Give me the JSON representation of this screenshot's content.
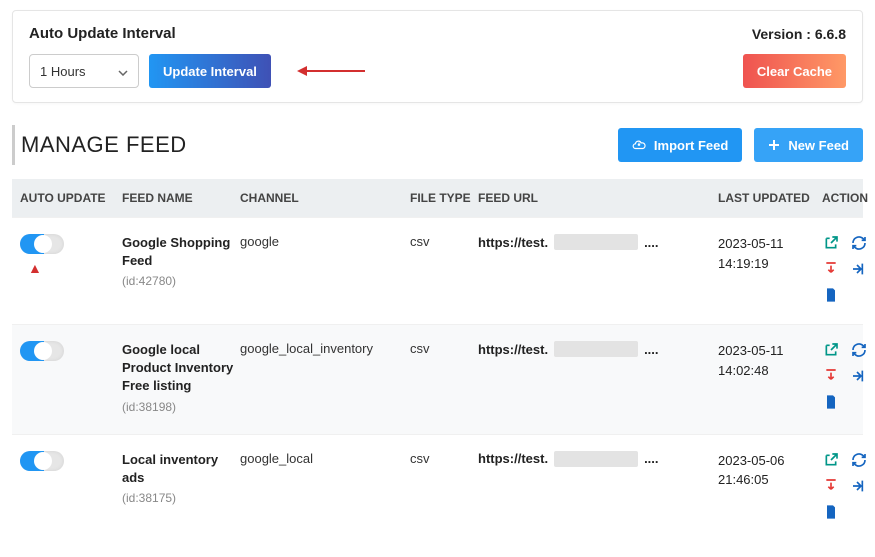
{
  "panel": {
    "title": "Auto Update Interval",
    "version_label": "Version : 6.6.8",
    "interval_selected": "1 Hours",
    "update_btn": "Update Interval",
    "clear_btn": "Clear Cache"
  },
  "manage": {
    "title": "MANAGE FEED",
    "import_btn": "Import Feed",
    "new_btn": "New Feed"
  },
  "columns": {
    "auto": "AUTO UPDATE",
    "name": "FEED NAME",
    "channel": "CHANNEL",
    "type": "FILE TYPE",
    "url": "FEED URL",
    "updated": "LAST UPDATED",
    "action": "ACTION"
  },
  "rows": [
    {
      "auto_on": true,
      "name": "Google Shopping Feed",
      "id": "(id:42780)",
      "channel": "google",
      "type": "csv",
      "url_prefix": "https://test.",
      "url_suffix": "....",
      "updated_date": "2023-05-11",
      "updated_time": "14:19:19"
    },
    {
      "auto_on": true,
      "name": "Google local Product Inventory Free listing",
      "id": "(id:38198)",
      "channel": "google_local_inventory",
      "type": "csv",
      "url_prefix": "https://test.",
      "url_suffix": "....",
      "updated_date": "2023-05-11",
      "updated_time": "14:02:48"
    },
    {
      "auto_on": true,
      "name": "Local inventory ads",
      "id": "(id:38175)",
      "channel": "google_local",
      "type": "csv",
      "url_prefix": "https://test.",
      "url_suffix": "....",
      "updated_date": "2023-05-06",
      "updated_time": "21:46:05"
    }
  ],
  "icons": {
    "open": "open-link-icon",
    "refresh": "refresh-icon",
    "download": "download-icon",
    "export": "export-icon",
    "file": "file-icon"
  }
}
